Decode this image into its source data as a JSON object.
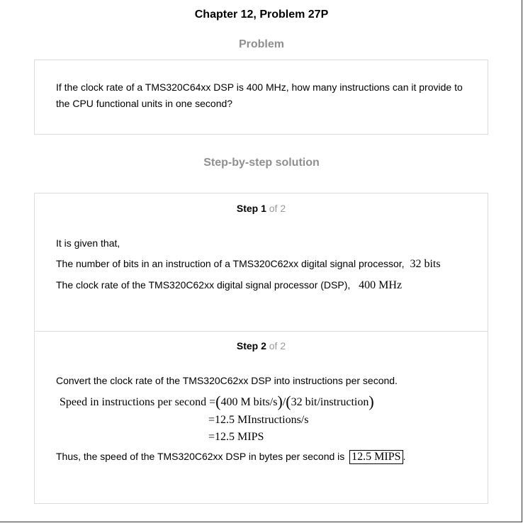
{
  "chapter_title": "Chapter 12, Problem 27P",
  "problem": {
    "heading": "Problem",
    "text": "If the clock rate of a TMS320C64xx DSP is 400 MHz, how many instructions can it provide to the CPU functional units in one second?"
  },
  "solution": {
    "heading": "Step-by-step solution",
    "step1": {
      "label": "Step 1",
      "of_text": "of 2",
      "given": "It is given that,",
      "line1_text": "The number of bits in an instruction of a TMS320C62xx digital signal processor,",
      "line1_value": "32 bits",
      "line2_text": "The clock rate of the TMS320C62xx digital signal processor (DSP),",
      "line2_value": "400 MHz"
    },
    "step2": {
      "label": "Step 2",
      "of_text": "of 2",
      "intro": "Convert the clock rate of the TMS320C62xx DSP into instructions per second.",
      "eq_lhs": "Speed in instructions per second",
      "eq_term1": "400 M bits/s",
      "eq_div": "/",
      "eq_term2": "32 bit/instruction",
      "eq_line2": "=12.5 MInstructions/s",
      "eq_line3": "=12.5 MIPS",
      "conclusion_text": "Thus, the speed of the TMS320C62xx DSP in bytes per second is",
      "answer": "12.5 MIPS",
      "conclusion_end": "."
    }
  }
}
